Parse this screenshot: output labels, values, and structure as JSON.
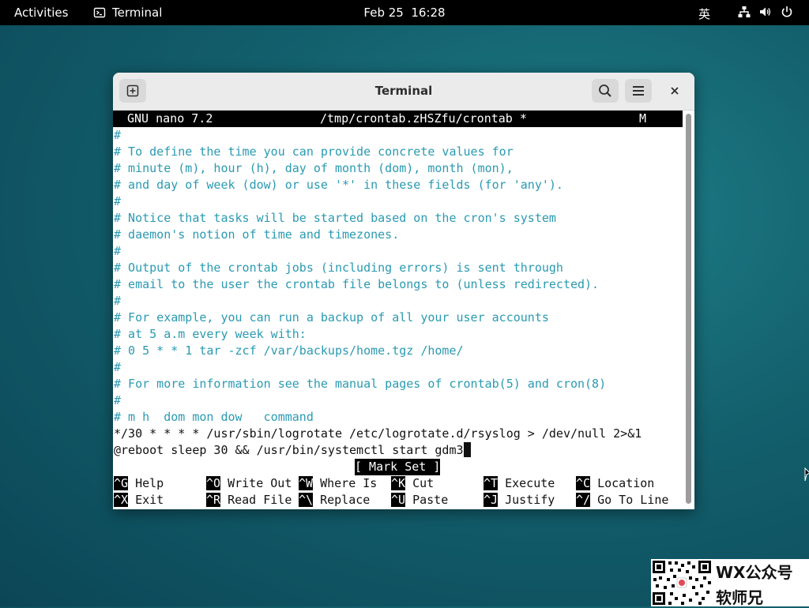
{
  "topbar": {
    "activities": "Activities",
    "app_name": "Terminal",
    "clock": "Feb 25  16:28",
    "ime": "英"
  },
  "window": {
    "title": "Terminal"
  },
  "nano": {
    "version": "GNU nano 7.2",
    "file": "/tmp/crontab.zHSZfu/crontab *",
    "modified_flag": "M",
    "lines": [
      {
        "text": "#",
        "type": "comment"
      },
      {
        "text": "# To define the time you can provide concrete values for",
        "type": "comment"
      },
      {
        "text": "# minute (m), hour (h), day of month (dom), month (mon),",
        "type": "comment"
      },
      {
        "text": "# and day of week (dow) or use '*' in these fields (for 'any').",
        "type": "comment"
      },
      {
        "text": "#",
        "type": "comment"
      },
      {
        "text": "# Notice that tasks will be started based on the cron's system",
        "type": "comment"
      },
      {
        "text": "# daemon's notion of time and timezones.",
        "type": "comment"
      },
      {
        "text": "#",
        "type": "comment"
      },
      {
        "text": "# Output of the crontab jobs (including errors) is sent through",
        "type": "comment"
      },
      {
        "text": "# email to the user the crontab file belongs to (unless redirected).",
        "type": "comment"
      },
      {
        "text": "#",
        "type": "comment"
      },
      {
        "text": "# For example, you can run a backup of all your user accounts",
        "type": "comment"
      },
      {
        "text": "# at 5 a.m every week with:",
        "type": "comment"
      },
      {
        "text": "# 0 5 * * 1 tar -zcf /var/backups/home.tgz /home/",
        "type": "comment"
      },
      {
        "text": "#",
        "type": "comment"
      },
      {
        "text": "# For more information see the manual pages of crontab(5) and cron(8)",
        "type": "comment"
      },
      {
        "text": "#",
        "type": "comment"
      },
      {
        "text": "# m h  dom mon dow   command",
        "type": "comment"
      },
      {
        "text": "*/30 * * * * /usr/sbin/logrotate /etc/logrotate.d/rsyslog > /dev/null 2>&1",
        "type": "cmd"
      },
      {
        "text": "@reboot sleep 30 && /usr/bin/systemctl start gdm3",
        "type": "cmd"
      }
    ],
    "status": "[ Mark Set ]",
    "shortcuts": [
      [
        {
          "key": "^G",
          "label": " Help"
        },
        {
          "key": "^O",
          "label": " Write Out"
        },
        {
          "key": "^W",
          "label": " Where Is"
        },
        {
          "key": "^K",
          "label": " Cut"
        },
        {
          "key": "^T",
          "label": " Execute"
        },
        {
          "key": "^C",
          "label": " Location"
        }
      ],
      [
        {
          "key": "^X",
          "label": " Exit"
        },
        {
          "key": "^R",
          "label": " Read File"
        },
        {
          "key": "^\\",
          "label": " Replace"
        },
        {
          "key": "^U",
          "label": " Paste"
        },
        {
          "key": "^J",
          "label": " Justify"
        },
        {
          "key": "^/",
          "label": " Go To Line"
        }
      ]
    ]
  },
  "watermark": {
    "line1": "WX公众号",
    "line2": "软师兄"
  }
}
